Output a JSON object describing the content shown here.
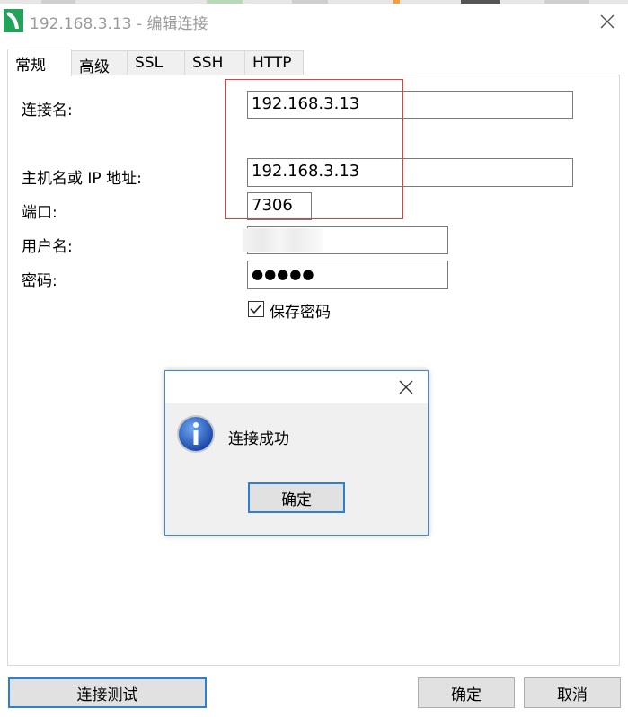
{
  "window": {
    "title": "192.168.3.13 - 编辑连接"
  },
  "tabs": [
    {
      "label": "常规",
      "active": true
    },
    {
      "label": "高级",
      "active": false
    },
    {
      "label": "SSL",
      "active": false
    },
    {
      "label": "SSH",
      "active": false
    },
    {
      "label": "HTTP",
      "active": false
    }
  ],
  "form": {
    "connection_name": {
      "label": "连接名:",
      "value": "192.168.3.13"
    },
    "host": {
      "label": "主机名或 IP 地址:",
      "value": "192.168.3.13"
    },
    "port": {
      "label": "端口:",
      "value": "7306"
    },
    "username": {
      "label": "用户名:",
      "value": ""
    },
    "password": {
      "label": "密码:",
      "value": "●●●●●"
    },
    "save_password": {
      "label": "保存密码",
      "checked": true
    }
  },
  "message_dialog": {
    "text": "连接成功",
    "ok_label": "确定",
    "icon": "info-icon"
  },
  "buttons": {
    "test_connection": "连接测试",
    "ok": "确定",
    "cancel": "取消"
  },
  "colors": {
    "accent_blue": "#2a7fd6",
    "highlight_red": "#e0403a",
    "app_icon_green": "#22a35a"
  }
}
